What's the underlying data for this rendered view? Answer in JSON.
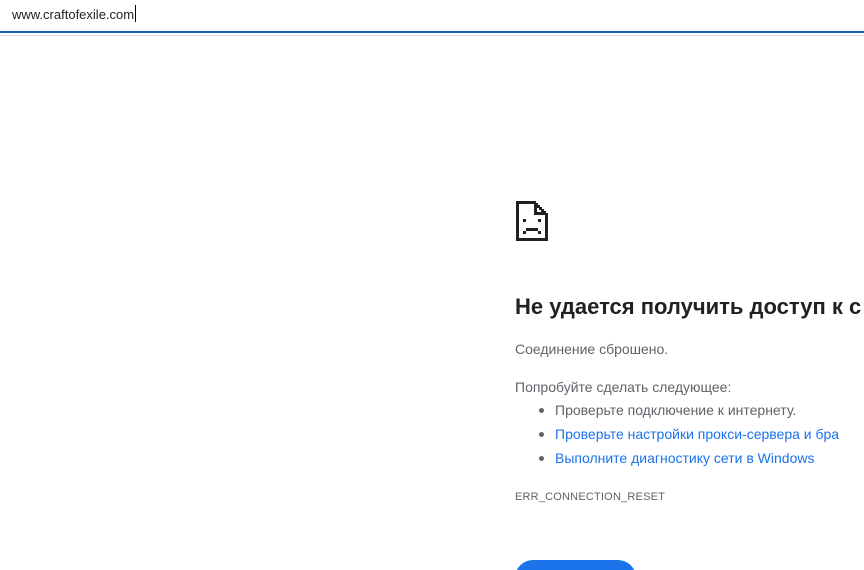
{
  "address_bar": {
    "url": "www.craftofexile.com"
  },
  "error_page": {
    "icon": "sad-page-icon",
    "title": "Не удается получить доступ к с",
    "message": "Соединение сброшено.",
    "suggestions_heading": "Попробуйте сделать следующее:",
    "suggestions": [
      {
        "text": "Проверьте подключение к интернету.",
        "is_link": false
      },
      {
        "text": "Проверьте настройки прокси-сервера и бра",
        "is_link": true
      },
      {
        "text": "Выполните диагностику сети в Windows",
        "is_link": true
      }
    ],
    "error_code": "ERR_CONNECTION_RESET"
  },
  "colors": {
    "accent": "#1a73e8",
    "address_underline": "#1a5fb4",
    "title_text": "#202124",
    "body_text": "#5f6368"
  }
}
